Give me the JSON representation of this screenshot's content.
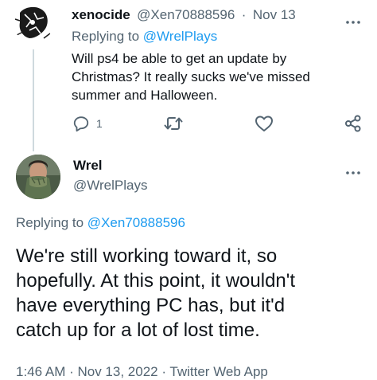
{
  "reply_tweet": {
    "display_name": "xenocide",
    "handle": "@Xen70888596",
    "separator": "·",
    "date": "Nov 13",
    "replying_prefix": "Replying to",
    "replying_handle": "@WrelPlays",
    "text_lines": [
      "Will ps4 be able to get an update by",
      "Christmas? It really sucks we've missed",
      "summer and Halloween."
    ],
    "actions": {
      "reply_count": "1"
    },
    "icons": [
      "more-icon",
      "reply-icon",
      "retweet-icon",
      "like-icon",
      "share-icon"
    ]
  },
  "main_tweet": {
    "display_name": "Wrel",
    "handle": "@WrelPlays",
    "replying_prefix": "Replying to",
    "replying_handle": "@Xen70888596",
    "text_lines": [
      "We're still working toward it, so",
      "hopefully. At this point, it wouldn't",
      "have everything PC has, but it'd",
      "catch up for a lot of lost time."
    ],
    "meta": "1:46 AM · Nov 13, 2022 · Twitter Web App"
  },
  "colors": {
    "text": "#0f1419",
    "muted": "#536471",
    "link": "#1d9bf0",
    "thread_line": "#cfd9de"
  }
}
